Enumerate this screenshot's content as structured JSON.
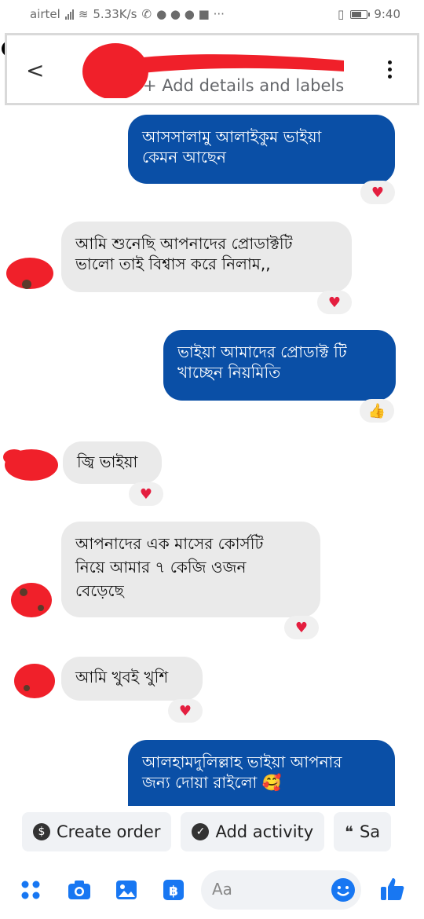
{
  "status": {
    "carrier": "airtel",
    "speed": "5.33K/s",
    "time": "9:40"
  },
  "header": {
    "subtitle": "+ Add details and labels"
  },
  "messages": [
    {
      "side": "out",
      "text_line1": "আসসালামু আলাইকুম ভাইয়া",
      "text_line2": "কেমন আছেন",
      "reaction": "heart"
    },
    {
      "side": "in",
      "text_line1": "আমি শুনেছি আপনাদের প্রোডাক্টটি",
      "text_line2": "ভালো তাই বিশ্বাস করে নিলাম,,",
      "reaction": "heart"
    },
    {
      "side": "out",
      "text_line1": "ভাইয়া আমাদের প্রোডাক্ট টি",
      "text_line2": "খাচ্ছেন নিয়মিতি",
      "reaction": "thumbs-up"
    },
    {
      "side": "in",
      "text_line1": "জ্বি ভাইয়া",
      "reaction": "heart"
    },
    {
      "side": "in",
      "text_line1": "আপনাদের এক মাসের কোর্সটি",
      "text_line2": "নিয়ে আমার ৭ কেজি ওজন",
      "text_line3": "বেড়েছে",
      "reaction": "heart"
    },
    {
      "side": "in",
      "text_line1": "আমি খুবই খুশি",
      "reaction": "heart"
    },
    {
      "side": "out",
      "text_line1": "আলহামদুলিল্লাহ ভাইয়া আপনার",
      "text_line2": "জন্য দোয়া রাইলো 🥰"
    }
  ],
  "actions": {
    "create_order": "Create order",
    "add_activity": "Add activity",
    "save": "Sa"
  },
  "composer": {
    "placeholder": "Aa"
  },
  "colors": {
    "outgoing_bubble": "#0a4fa6",
    "incoming_bubble": "#eaeaea",
    "accent": "#1877f2",
    "heart": "#e41e3f",
    "redaction": "#f0202a"
  },
  "icons": [
    "back-icon",
    "menu-dots-icon",
    "heart-icon",
    "thumbs-up-icon",
    "dollar-icon",
    "check-circle-icon",
    "chat-icon",
    "apps-icon",
    "camera-icon",
    "image-icon",
    "baht-icon",
    "emoji-icon",
    "like-icon"
  ]
}
